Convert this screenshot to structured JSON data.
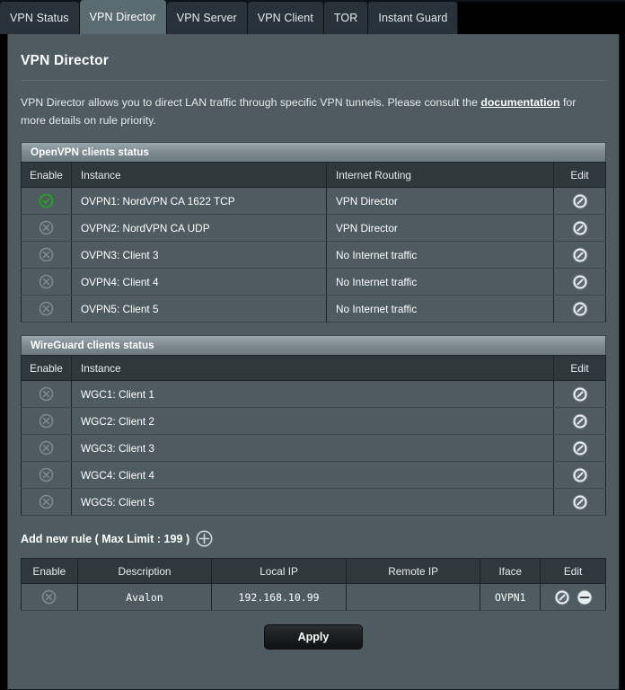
{
  "tabs": [
    {
      "label": "VPN Status",
      "active": false
    },
    {
      "label": "VPN Director",
      "active": true
    },
    {
      "label": "VPN Server",
      "active": false
    },
    {
      "label": "VPN Client",
      "active": false
    },
    {
      "label": "TOR",
      "active": false
    },
    {
      "label": "Instant Guard",
      "active": false
    }
  ],
  "page": {
    "title": "VPN Director",
    "description_before": "VPN Director allows you to direct LAN traffic through specific VPN tunnels. Please consult the ",
    "description_link": "documentation",
    "description_after": " for more details on rule priority."
  },
  "openvpn": {
    "section_title": "OpenVPN clients status",
    "columns": [
      "Enable",
      "Instance",
      "Internet Routing",
      "Edit"
    ],
    "rows": [
      {
        "enabled": true,
        "enable_icon": "check-circle-icon",
        "instance": "OVPN1: NordVPN CA 1622 TCP",
        "routing": "VPN Director",
        "routing_on": true,
        "edit_icon": "edit-pencil-icon"
      },
      {
        "enabled": false,
        "enable_icon": "x-circle-icon",
        "instance": "OVPN2: NordVPN CA UDP",
        "routing": "VPN Director",
        "routing_on": true,
        "edit_icon": "edit-pencil-icon"
      },
      {
        "enabled": false,
        "enable_icon": "x-circle-icon",
        "instance": "OVPN3: Client 3",
        "routing": "No Internet traffic",
        "routing_on": false,
        "edit_icon": "edit-pencil-icon"
      },
      {
        "enabled": false,
        "enable_icon": "x-circle-icon",
        "instance": "OVPN4: Client 4",
        "routing": "No Internet traffic",
        "routing_on": false,
        "edit_icon": "edit-pencil-icon"
      },
      {
        "enabled": false,
        "enable_icon": "x-circle-icon",
        "instance": "OVPN5: Client 5",
        "routing": "No Internet traffic",
        "routing_on": false,
        "edit_icon": "edit-pencil-icon"
      }
    ]
  },
  "wireguard": {
    "section_title": "WireGuard clients status",
    "columns": [
      "Enable",
      "Instance",
      "Edit"
    ],
    "rows": [
      {
        "enabled": false,
        "enable_icon": "x-circle-icon",
        "instance": "WGC1: Client 1",
        "edit_icon": "edit-pencil-icon"
      },
      {
        "enabled": false,
        "enable_icon": "x-circle-icon",
        "instance": "WGC2: Client 2",
        "edit_icon": "edit-pencil-icon"
      },
      {
        "enabled": false,
        "enable_icon": "x-circle-icon",
        "instance": "WGC3: Client 3",
        "edit_icon": "edit-pencil-icon"
      },
      {
        "enabled": false,
        "enable_icon": "x-circle-icon",
        "instance": "WGC4: Client 4",
        "edit_icon": "edit-pencil-icon"
      },
      {
        "enabled": false,
        "enable_icon": "x-circle-icon",
        "instance": "WGC5: Client 5",
        "edit_icon": "edit-pencil-icon"
      }
    ]
  },
  "rules": {
    "add_label": "Add new rule ( Max Limit : 199 )",
    "add_icon": "plus-circle-icon",
    "columns": [
      "Enable",
      "Description",
      "Local IP",
      "Remote IP",
      "Iface",
      "Edit"
    ],
    "rows": [
      {
        "enabled": false,
        "enable_icon": "x-circle-icon",
        "description": "Avalon",
        "local_ip": "192.168.10.99",
        "remote_ip": "",
        "iface": "OVPN1",
        "edit_icon": "edit-pencil-icon",
        "remove_icon": "minus-circle-icon"
      }
    ]
  },
  "footer": {
    "apply_label": "Apply"
  },
  "colors": {
    "panel_bg": "#4e5b60",
    "header_row_bg": "#2e383d",
    "accent_orange": "#f0a623",
    "enabled_green": "#23a61f",
    "active_tab_bg": "#5a6b72",
    "inactive_tab_bg": "#27323a"
  }
}
